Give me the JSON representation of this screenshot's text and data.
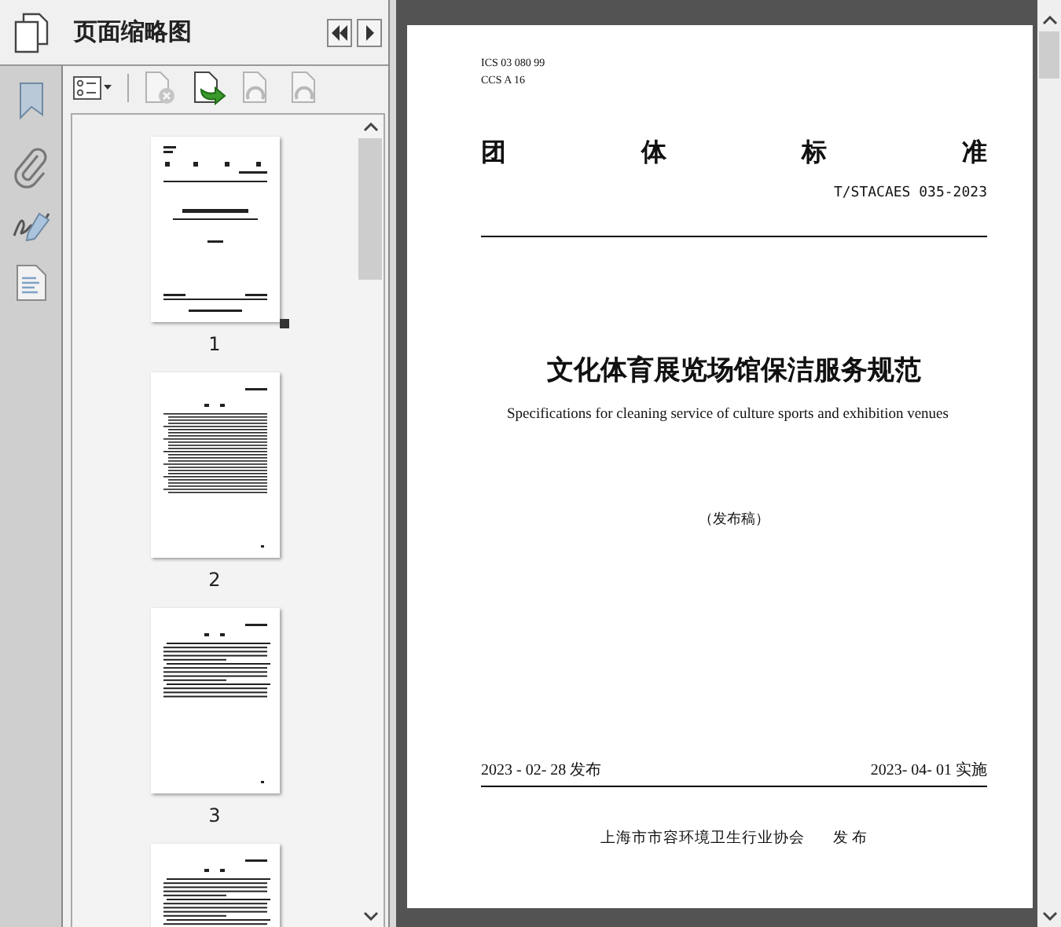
{
  "panel": {
    "title": "页面缩略图",
    "nav_buttons": [
      {
        "kind": "rewind",
        "disabled": false
      },
      {
        "kind": "next",
        "disabled": false
      }
    ],
    "tools": [
      {
        "kind": "options",
        "disabled": false
      },
      {
        "kind": "delete",
        "disabled": true
      },
      {
        "kind": "insert",
        "disabled": false
      },
      {
        "kind": "undo",
        "disabled": true
      },
      {
        "kind": "redo",
        "disabled": true
      }
    ],
    "thumbnails": [
      {
        "kind": "cover",
        "label": "1",
        "current": true
      },
      {
        "kind": "toc",
        "label": "2",
        "current": false
      },
      {
        "kind": "text",
        "label": "3",
        "current": false
      },
      {
        "kind": "text",
        "current": false
      }
    ]
  },
  "document": {
    "ics": "ICS  03 080 99",
    "ccs": "CCS  A 16",
    "heading": [
      "团",
      "体",
      "标",
      "准"
    ],
    "code": "T/STACAES 035-2023",
    "title": "文化体育展览场馆保洁服务规范",
    "subtitle": "Specifications for cleaning service of culture sports and exhibition venues",
    "status": "（发布稿）",
    "issue_date": "2023 - 02- 28 发布",
    "implement_date": "2023- 04- 01 实施",
    "publisher": "上海市市容环境卫生行业协会",
    "publish": "发 布"
  }
}
